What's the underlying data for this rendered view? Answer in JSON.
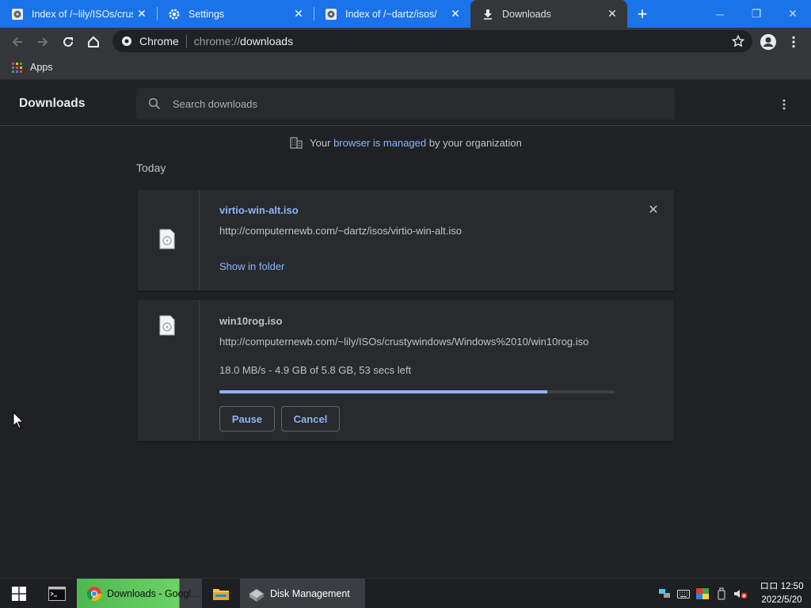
{
  "browser": {
    "tabs": [
      {
        "title": "Index of /~lily/ISOs/crusty",
        "icon": "disc-icon",
        "active": false
      },
      {
        "title": "Settings",
        "icon": "gear-icon",
        "active": false
      },
      {
        "title": "Index of /~dartz/isos/",
        "icon": "disc-icon",
        "active": false
      },
      {
        "title": "Downloads",
        "icon": "download-icon",
        "active": true
      }
    ],
    "new_tab_label": "+",
    "omnibox": {
      "chip": "Chrome",
      "url_scheme": "chrome://",
      "url_path": "downloads"
    },
    "bookmarks": {
      "apps_label": "Apps"
    }
  },
  "downloads": {
    "title": "Downloads",
    "search_placeholder": "Search downloads",
    "managed_notice": {
      "prefix": "Your ",
      "link": "browser is managed",
      "suffix": " by your organization"
    },
    "date_header": "Today",
    "items": [
      {
        "filename": "virtio-win-alt.iso",
        "url": "http://computernewb.com/~dartz/isos/virtio-win-alt.iso",
        "action_link": "Show in folder",
        "state": "complete"
      },
      {
        "filename": "win10rog.iso",
        "url": "http://computernewb.com/~lily/ISOs/crustywindows/Windows%2010/win10rog.iso",
        "status": "18.0 MB/s - 4.9 GB of 5.8 GB, 53 secs left",
        "progress": 0.83,
        "pause_label": "Pause",
        "cancel_label": "Cancel",
        "state": "in_progress"
      }
    ]
  },
  "taskbar": {
    "chrome_label": "Downloads - Googl...",
    "disk_label": "Disk Management",
    "clock_time": "ロロ 12:50",
    "clock_date": "2022/5/20"
  },
  "colors": {
    "accent_tab": "#1a73e8",
    "link": "#8ab4f8",
    "page_bg": "#202124",
    "card_bg": "#292a2d"
  }
}
